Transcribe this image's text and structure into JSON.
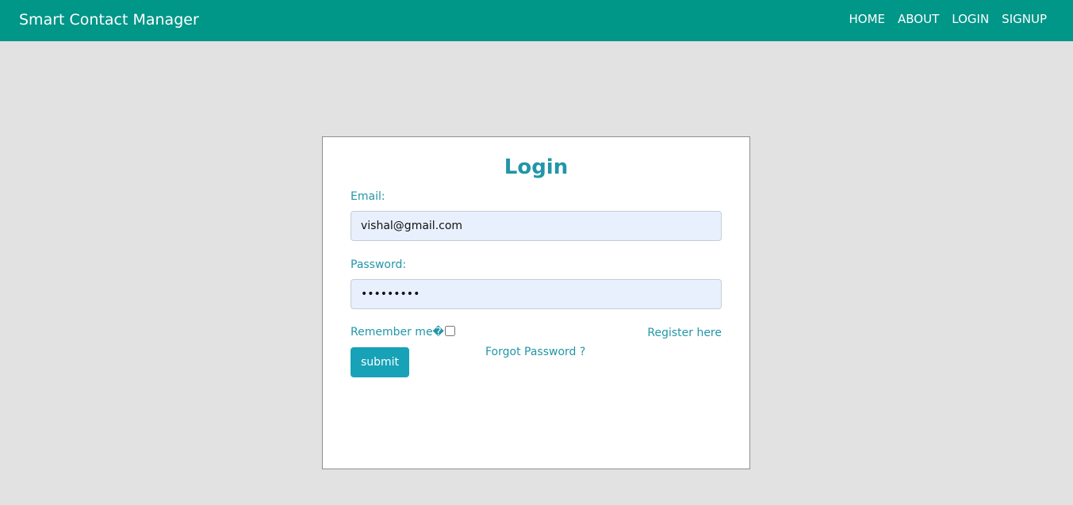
{
  "navbar": {
    "brand": "Smart Contact Manager",
    "links": [
      "HOME",
      "ABOUT",
      "LOGIN",
      "SIGNUP"
    ]
  },
  "login": {
    "title": "Login",
    "email_label": "Email:",
    "email_value": "vishal@gmail.com",
    "password_label": "Password:",
    "password_value": "•••••••••",
    "remember_label": "Remember me�",
    "remember_checked": false,
    "register_link": "Register here",
    "forgot_link": "Forgot Password ?",
    "submit_label": "submit"
  },
  "colors": {
    "navbar_bg": "#009688",
    "page_bg": "#e2e2e2",
    "accent_text": "#2196a8",
    "button_bg": "#17a2b8",
    "input_bg": "#e8f0fe"
  }
}
